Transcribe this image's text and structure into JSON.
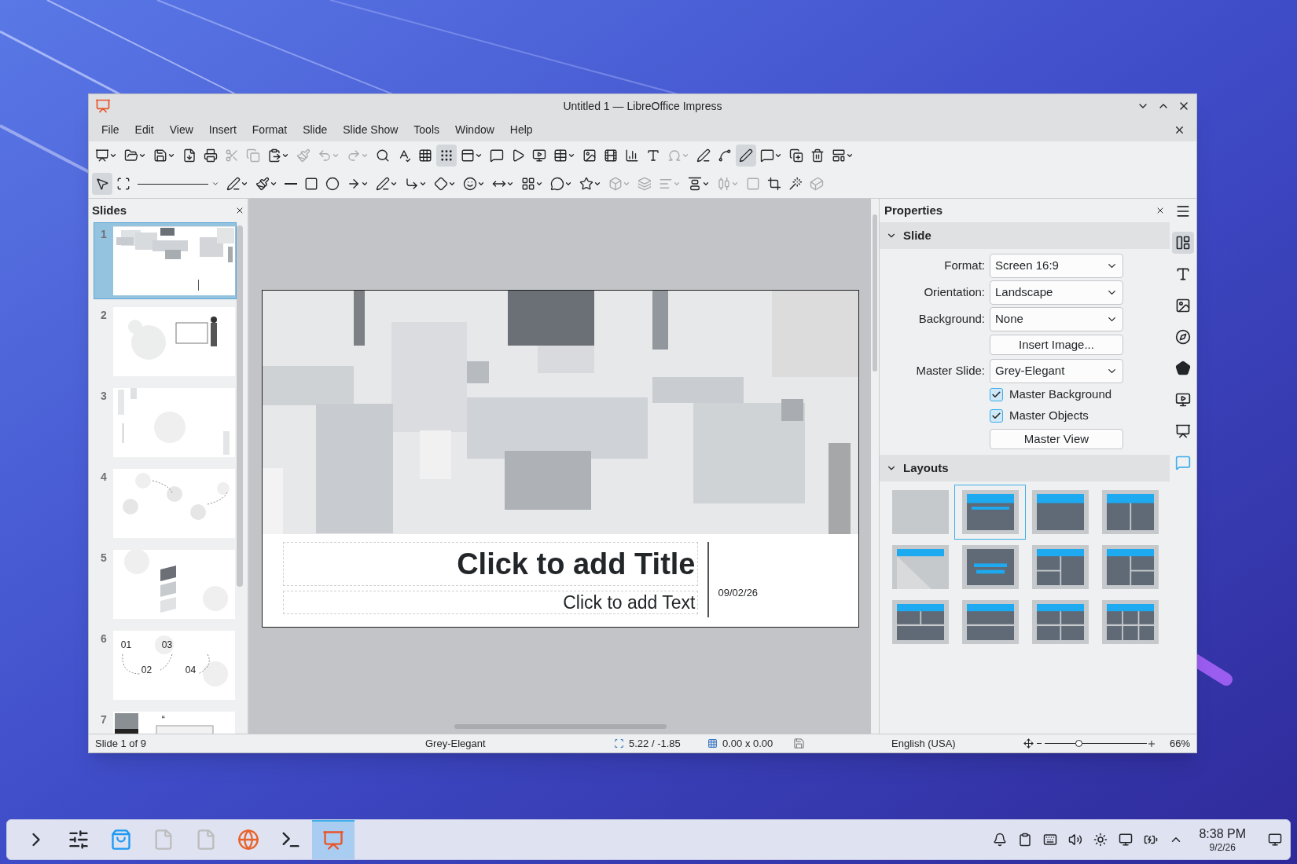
{
  "window": {
    "title": "Untitled 1 — LibreOffice Impress"
  },
  "menu": [
    "File",
    "Edit",
    "View",
    "Insert",
    "Format",
    "Slide",
    "Slide Show",
    "Tools",
    "Window",
    "Help"
  ],
  "toolbar_1": [
    {
      "on": false,
      "disabled": false
    },
    {
      "on": false,
      "disabled": false
    },
    {
      "on": false,
      "disabled": false
    },
    {
      "on": false,
      "disabled": false
    },
    {
      "on": false,
      "disabled": false
    },
    {
      "on": false,
      "disabled": true
    },
    {
      "on": false,
      "disabled": true
    },
    {
      "on": false,
      "disabled": false
    },
    {
      "on": false,
      "disabled": true
    },
    {
      "on": false,
      "disabled": true
    },
    {
      "on": false,
      "disabled": true
    },
    {
      "on": false,
      "disabled": false
    },
    {
      "on": false,
      "disabled": false
    },
    {
      "on": false,
      "disabled": false
    },
    {
      "on": true,
      "disabled": false
    },
    {
      "on": false,
      "disabled": false
    },
    {
      "on": false,
      "disabled": false
    },
    {
      "on": false,
      "disabled": false
    },
    {
      "on": false,
      "disabled": false
    },
    {
      "on": false,
      "disabled": false
    },
    {
      "on": false,
      "disabled": false
    },
    {
      "on": false,
      "disabled": false
    },
    {
      "on": false,
      "disabled": false
    },
    {
      "on": false,
      "disabled": false
    },
    {
      "on": false,
      "disabled": true
    },
    {
      "on": false,
      "disabled": false
    },
    {
      "on": false,
      "disabled": false
    },
    {
      "on": true,
      "disabled": false
    },
    {
      "on": false,
      "disabled": false
    },
    {
      "on": false,
      "disabled": false
    },
    {
      "on": false,
      "disabled": false
    },
    {
      "on": false,
      "disabled": false
    }
  ],
  "toolbar_2": [
    {
      "on": true,
      "disabled": false
    },
    {
      "on": false,
      "disabled": false
    },
    {
      "on": false,
      "disabled": false
    },
    {
      "on": false,
      "disabled": false
    },
    {
      "on": false,
      "disabled": false
    },
    {
      "on": false,
      "disabled": false
    },
    {
      "on": false,
      "disabled": false
    },
    {
      "on": false,
      "disabled": false
    },
    {
      "on": false,
      "disabled": false
    },
    {
      "on": false,
      "disabled": false
    },
    {
      "on": false,
      "disabled": false
    },
    {
      "on": false,
      "disabled": false
    },
    {
      "on": false,
      "disabled": false
    },
    {
      "on": false,
      "disabled": false
    },
    {
      "on": false,
      "disabled": false
    },
    {
      "on": false,
      "disabled": false
    },
    {
      "on": false,
      "disabled": false
    },
    {
      "on": false,
      "disabled": true
    },
    {
      "on": false,
      "disabled": true
    },
    {
      "on": false,
      "disabled": true
    },
    {
      "on": false,
      "disabled": false
    },
    {
      "on": false,
      "disabled": true
    },
    {
      "on": false,
      "disabled": true
    },
    {
      "on": false,
      "disabled": false
    },
    {
      "on": false,
      "disabled": false
    },
    {
      "on": false,
      "disabled": true
    }
  ],
  "slides_panel": {
    "title": "Slides",
    "slides": [
      {
        "number": "1",
        "selected": true
      },
      {
        "number": "2",
        "selected": false
      },
      {
        "number": "3",
        "selected": false
      },
      {
        "number": "4",
        "selected": false
      },
      {
        "number": "5",
        "selected": false
      },
      {
        "number": "6",
        "selected": false,
        "texts": [
          "01",
          "03",
          "02",
          "04"
        ]
      },
      {
        "number": "7",
        "selected": false,
        "texts": [
          "“"
        ]
      }
    ]
  },
  "slide": {
    "title_placeholder": "Click to add Title",
    "text_placeholder": "Click to add Text",
    "date": "09/02/26"
  },
  "properties": {
    "title": "Properties",
    "slide_section": {
      "title": "Slide",
      "expanded": true,
      "rows": [
        {
          "kind": "dropdown",
          "label": "Format:",
          "value": "Screen 16:9"
        },
        {
          "kind": "dropdown",
          "label": "Orientation:",
          "value": "Landscape"
        },
        {
          "kind": "dropdown",
          "label": "Background:",
          "value": "None"
        },
        {
          "kind": "button",
          "label": "Insert Image..."
        },
        {
          "kind": "dropdown",
          "label": "Master Slide:",
          "value": "Grey-Elegant"
        },
        {
          "kind": "checkbox",
          "label": "Master Background",
          "checked": true
        },
        {
          "kind": "checkbox",
          "label": "Master Objects",
          "checked": true
        },
        {
          "kind": "button",
          "label": "Master View"
        }
      ]
    },
    "layouts_section": {
      "title": "Layouts",
      "expanded": true,
      "layouts": [
        {
          "selected": false
        },
        {
          "selected": true
        },
        {
          "selected": false
        },
        {
          "selected": false
        },
        {
          "selected": false
        },
        {
          "selected": false
        },
        {
          "selected": false
        },
        {
          "selected": false
        },
        {
          "selected": false
        },
        {
          "selected": false
        },
        {
          "selected": false
        },
        {
          "selected": false
        }
      ]
    }
  },
  "sidebar_tabs": [
    {
      "selected": false
    },
    {
      "selected": true
    },
    {
      "selected": false
    },
    {
      "selected": false
    },
    {
      "selected": false
    },
    {
      "selected": false
    },
    {
      "selected": false
    },
    {
      "selected": false
    },
    {
      "selected": false
    }
  ],
  "status_bar": {
    "slide": "Slide 1 of 9",
    "master": "Grey-Elegant",
    "position": "5.22 / -1.85",
    "size": "0.00 x 0.00",
    "language": "English (USA)",
    "zoom": {
      "level": 0.33
    },
    "zoom_reading": "66%"
  },
  "taskbar": {
    "apps": [
      {
        "selected": false
      },
      {
        "selected": false
      },
      {
        "selected": false
      },
      {
        "selected": false
      },
      {
        "selected": false
      },
      {
        "selected": false
      },
      {
        "selected": false
      },
      {
        "selected": true
      }
    ],
    "time": "8:38 PM",
    "date": "9/2/26"
  }
}
